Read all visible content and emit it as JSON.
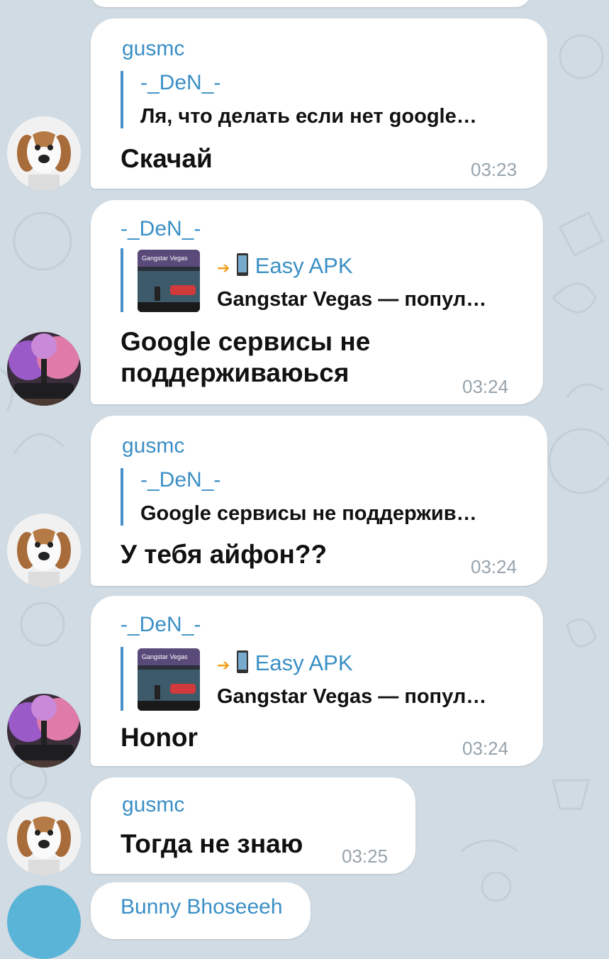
{
  "messages": [
    {
      "sender": "gusmc",
      "reply_name": "-_DeN_-",
      "reply_text": "Ля, что делать если нет google…",
      "text": "Скачай",
      "time": "03:23"
    },
    {
      "sender": "-_DeN_-",
      "link_thumb_text": "Gangstar Vegas",
      "link_title": "Easy APK",
      "link_desc": "Gangstar Vegas — попул…",
      "text_line1": "Google сервисы не",
      "text_line2": "поддерживаюься",
      "time": "03:24"
    },
    {
      "sender": "gusmc",
      "reply_name": "-_DeN_-",
      "reply_text": "Google сервисы не поддержив…",
      "text": "У тебя айфон??",
      "time": "03:24"
    },
    {
      "sender": "-_DeN_-",
      "link_thumb_text": "Gangstar Vegas",
      "link_title": "Easy APK",
      "link_desc": "Gangstar Vegas — попул…",
      "text": "Honor",
      "time": "03:24"
    },
    {
      "sender": "gusmc",
      "text": "Тогда не знаю",
      "time": "03:25"
    },
    {
      "sender": "Bunny Bhoseeeh"
    }
  ],
  "colors": {
    "background": "#d1dbe3",
    "bubble": "#ffffff",
    "name": "#3b8fc6",
    "reply_bar": "#4a90c8",
    "time": "#97a4ad"
  },
  "icons": [
    "puppy-avatar",
    "smoke-car-avatar",
    "arrow-right-icon",
    "phone-icon"
  ]
}
